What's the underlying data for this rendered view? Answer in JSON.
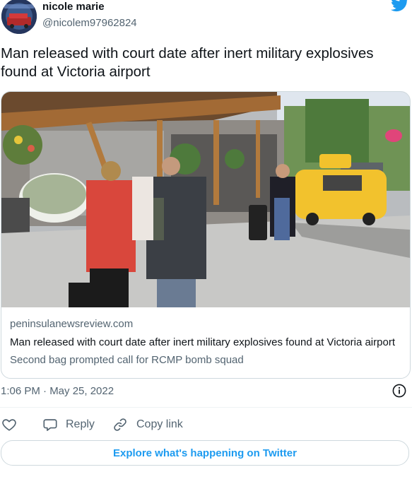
{
  "author": {
    "name": "nicole marie",
    "handle": "@nicolem97962824"
  },
  "tweet": {
    "text": "Man released with court date after inert military explosives found at Victoria airport"
  },
  "card": {
    "domain": "peninsulanewsreview.com",
    "title": "Man released with court date after inert military explosives found at Victoria airport",
    "description": "Second bag prompted call for RCMP bomb squad"
  },
  "meta": {
    "timestamp": "1:06 PM · May 25, 2022"
  },
  "actions": {
    "reply_label": "Reply",
    "copy_link_label": "Copy link"
  },
  "explore": {
    "label": "Explore what's happening on Twitter"
  },
  "icons": {
    "logo": "twitter-bird-icon",
    "info": "info-icon",
    "like": "heart-icon",
    "reply": "speech-bubble-icon",
    "copy": "link-icon"
  },
  "colors": {
    "brand": "#1d9bf0",
    "text": "#0f1419",
    "muted": "#536471",
    "border": "#cfd9de"
  }
}
